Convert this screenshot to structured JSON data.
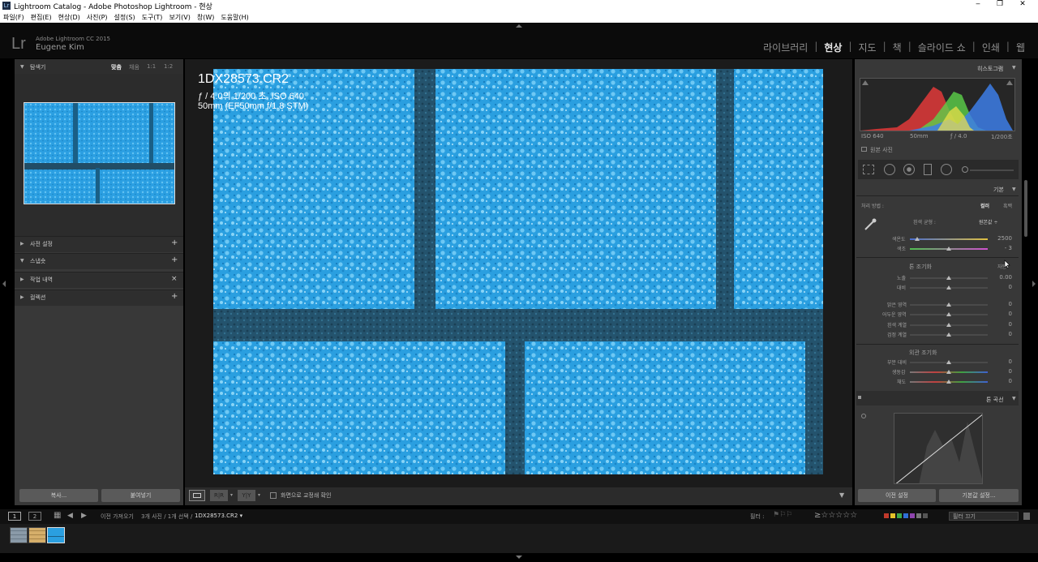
{
  "window": {
    "title": "Lightroom Catalog - Adobe Photoshop Lightroom - 현상",
    "minimize": "‒",
    "restore": "❐",
    "close": "✕"
  },
  "menu": [
    "파일(F)",
    "편집(E)",
    "현상(D)",
    "사진(P)",
    "설정(S)",
    "도구(T)",
    "보기(V)",
    "창(W)",
    "도움말(H)"
  ],
  "identity": {
    "logo": "Lr",
    "version": "Adobe Lightroom CC 2015",
    "user": "Eugene Kim"
  },
  "modules": [
    "라이브러리",
    "현상",
    "지도",
    "책",
    "슬라이드 쇼",
    "인쇄",
    "웹"
  ],
  "active_module": "현상",
  "left": {
    "navigator": {
      "title": "탐색기",
      "zoom": [
        "맞춤",
        "채움",
        "1:1",
        "1:2"
      ]
    },
    "presets": "사전 설정",
    "snapshots": "스냅숏",
    "history": "작업 내역",
    "collections": "컬렉션",
    "copy_btn": "복사...",
    "paste_btn": "붙여넣기"
  },
  "photo_info": {
    "filename": "1DX28573.CR2",
    "exposure": "ƒ / 4.0의 1/200 초, ISO 640",
    "lens": "50mm (EF50mm f/1.8 STM)"
  },
  "toolbar": {
    "proof_label": "화면으로 교정쇄 확인"
  },
  "right": {
    "histogram": {
      "title": "히스토그램",
      "iso": "ISO 640",
      "focal": "50mm",
      "aperture": "ƒ / 4.0",
      "shutter": "1/200초",
      "original_photo": "원본 사진"
    },
    "basic": {
      "title": "기본",
      "treatment_label": "처리 방법 :",
      "treatment_color": "컬러",
      "treatment_bw": "흑백",
      "wb_label": "흰색 균형 :",
      "wb_value": "원본값 ÷",
      "temp_label": "색온도",
      "temp_value": "2500",
      "tint_label": "색조",
      "tint_value": "- 3",
      "tone_title": "톤 조기화",
      "tone_auto": "자동",
      "exposure_label": "노출",
      "exposure_value": "0.00",
      "contrast_label": "대비",
      "contrast_value": "0",
      "highlights_label": "밝은 영역",
      "highlights_value": "0",
      "shadows_label": "어두운 영역",
      "shadows_value": "0",
      "whites_label": "흰색 계열",
      "whites_value": "0",
      "blacks_label": "검정 계열",
      "blacks_value": "0",
      "presence_title": "외관 조기화",
      "clarity_label": "부분 대비",
      "clarity_value": "0",
      "vibrance_label": "생동감",
      "vibrance_value": "0",
      "saturation_label": "채도",
      "saturation_value": "0"
    },
    "tone_curve": {
      "title": "톤 곡선"
    },
    "prev_btn": "이전 설정",
    "reset_btn": "기본값 설정..."
  },
  "filmstrip": {
    "page1": "1",
    "page2": "2",
    "source": "이전 가져오기",
    "count": "3개 사진 / 1개 선택 /",
    "current_file": "1DX28573.CR2 ▾",
    "filter_label": "필터 :",
    "filter_dropdown": "필터 끄기"
  },
  "colors": {
    "accent": "#2a9fe0",
    "panel": "#383838",
    "background": "#000000"
  }
}
